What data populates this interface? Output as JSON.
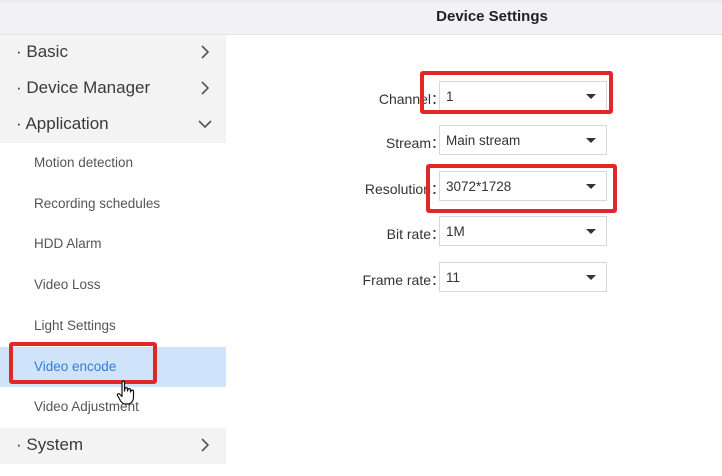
{
  "header": {
    "title": "Device Settings"
  },
  "sidebar": {
    "sections": [
      {
        "label": "· Basic",
        "expanded": false
      },
      {
        "label": "· Device Manager",
        "expanded": false
      },
      {
        "label": "· Application",
        "expanded": true
      },
      {
        "label": "· System",
        "expanded": false
      }
    ],
    "application_items": [
      {
        "label": "Motion detection"
      },
      {
        "label": "Recording schedules"
      },
      {
        "label": "HDD Alarm"
      },
      {
        "label": "Video Loss"
      },
      {
        "label": "Light Settings"
      },
      {
        "label": "Video encode",
        "active": true
      },
      {
        "label": "Video Adjustment"
      }
    ]
  },
  "form": {
    "fields": [
      {
        "label": "Channel：",
        "value": "1"
      },
      {
        "label": "Stream：",
        "value": "Main stream"
      },
      {
        "label": "Resolution：",
        "value": "3072*1728"
      },
      {
        "label": "Bit rate：",
        "value": "1M"
      },
      {
        "label": "Frame rate：",
        "value": "11"
      }
    ]
  },
  "colors": {
    "highlight": "#e02828",
    "active_bg": "#cfe3fb",
    "active_text": "#2d7fd8",
    "section_bg": "#f3f3f3"
  }
}
